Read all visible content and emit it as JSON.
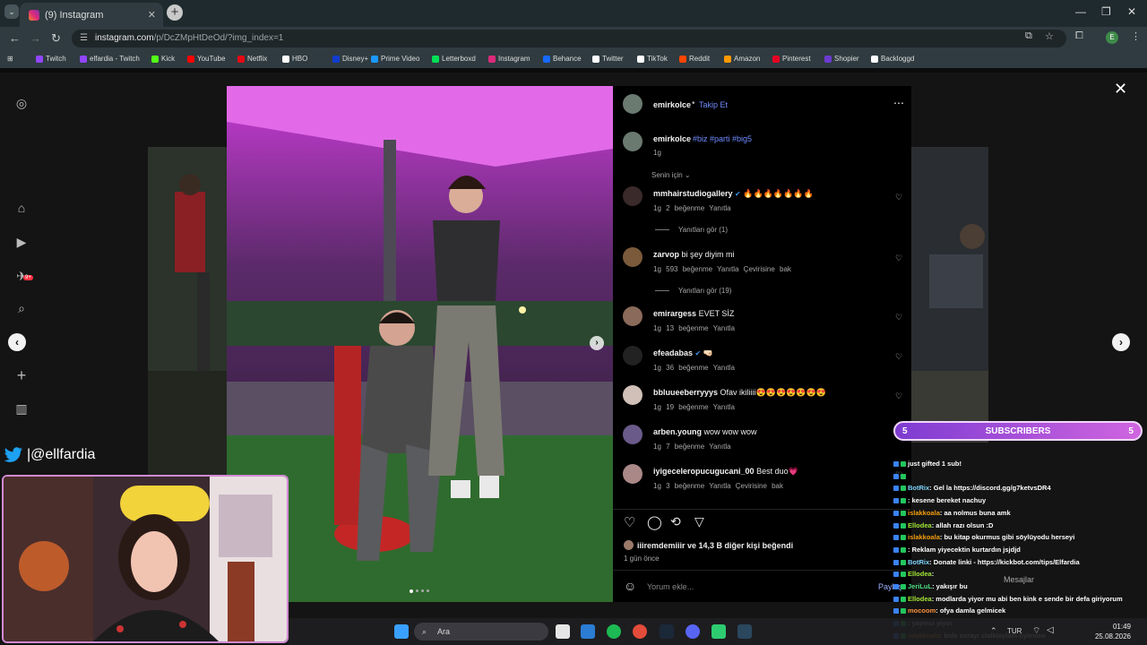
{
  "browser": {
    "tab_title": "(9) Instagram",
    "url_host": "instagram.com",
    "url_rest": "/p/DcZMpHtDeOd/?img_index=1",
    "profile_initial": "E",
    "bookmarks": [
      {
        "label": "Twitch",
        "color": "#9146ff"
      },
      {
        "label": "elfardia - Twitch",
        "color": "#9146ff"
      },
      {
        "label": "Kick",
        "color": "#53fc18"
      },
      {
        "label": "YouTube",
        "color": "#ff0000"
      },
      {
        "label": "Netflix",
        "color": "#e50914"
      },
      {
        "label": "HBO",
        "color": "#ffffff"
      },
      {
        "label": "Disney+",
        "color": "#113ccf"
      },
      {
        "label": "Prime Video",
        "color": "#1a98ff"
      },
      {
        "label": "Letterboxd",
        "color": "#00e054"
      },
      {
        "label": "Instagram",
        "color": "#dd2a7b"
      },
      {
        "label": "Behance",
        "color": "#1769ff"
      },
      {
        "label": "Twitter",
        "color": "#ffffff"
      },
      {
        "label": "TikTok",
        "color": "#ffffff"
      },
      {
        "label": "Reddit",
        "color": "#ff4500"
      },
      {
        "label": "Amazon",
        "color": "#ff9900"
      },
      {
        "label": "Pinterest",
        "color": "#e60023"
      },
      {
        "label": "Shopier",
        "color": "#6c3bd1"
      },
      {
        "label": "Backloggd",
        "color": "#ffffff"
      }
    ]
  },
  "instagram": {
    "notification_count": "9+",
    "post_author": "emirkolce",
    "follow_label": "Takip Et",
    "caption_user": "emirkolce",
    "caption_tags": "#biz #parti #big5",
    "caption_age": "1g",
    "sort_label": "Senin için",
    "comments": [
      {
        "user": "mmhairstudiogallery",
        "verified": true,
        "text": "🔥🔥🔥🔥🔥🔥🔥",
        "meta": "1g  2 beğenme  Yanıtla",
        "replies": "Yanıtları gör (1)"
      },
      {
        "user": "zarvop",
        "verified": false,
        "text": "bi şey diyim mi",
        "meta": "1g  593 beğenme  Yanıtla  Çevirisine bak",
        "replies": "Yanıtları gör (19)"
      },
      {
        "user": "emirargess",
        "verified": false,
        "text": "EVET SİZ",
        "meta": "1g  13 beğenme  Yanıtla",
        "replies": ""
      },
      {
        "user": "efeadabas",
        "verified": true,
        "text": "🤜🏻",
        "meta": "1g  36 beğenme  Yanıtla",
        "replies": ""
      },
      {
        "user": "bbluueeberryyys",
        "verified": false,
        "text": "Ofav ikiliiii😍😍😍😍😍😍😍",
        "meta": "1g  19 beğenme  Yanıtla",
        "replies": ""
      },
      {
        "user": "arben.young",
        "verified": false,
        "text": "wow wow wow",
        "meta": "1g  7 beğenme  Yanıtla",
        "replies": ""
      },
      {
        "user": "iyigeceleropucugucani_00",
        "verified": false,
        "text": "Best duo💗",
        "meta": "1g  3 beğenme  Yanıtla  Çevirisine bak",
        "replies": ""
      }
    ],
    "likes_text": "iiiremdemiiir ve 14,3 B diğer kişi beğendi",
    "post_age": "1 gün önce",
    "comment_placeholder": "Yorum ekle...",
    "post_button": "Paylaş",
    "messages_label": "Mesajlar"
  },
  "stream": {
    "twitter_handle": "|@ellfardia",
    "subscribers_label": "SUBSCRIBERS",
    "subscribers_count": "5",
    "chat": [
      {
        "user": "",
        "text": "just gifted 1 sub!",
        "color": "#ff6b6b"
      },
      {
        "user": "",
        "text": "",
        "color": "#ff6b6b"
      },
      {
        "user": "BotRix",
        "text": ": Gel la https://discord.gg/g7ketvsDR4",
        "color": "#7dd3fc"
      },
      {
        "user": "",
        "text": ": kesene bereket nachuy",
        "color": "#c084fc"
      },
      {
        "user": "islakkoala",
        "text": ": aa nolmus buna amk",
        "color": "#f59e0b"
      },
      {
        "user": "Ellodea",
        "text": ": allah razı olsun :D",
        "color": "#a3e635"
      },
      {
        "user": "islakkoala",
        "text": ": bu kitap okurmus gibi söylüyodu herseyi",
        "color": "#f59e0b"
      },
      {
        "user": "",
        "text": ": Reklam yiyecektin kurtardın jsjdjd",
        "color": "#ff6b6b"
      },
      {
        "user": "BotRix",
        "text": ": Donate linki - https://kickbot.com/tips/Elfardia",
        "color": "#7dd3fc"
      },
      {
        "user": "Ellodea",
        "text": ":",
        "color": "#a3e635"
      },
      {
        "user": "JeriLuL",
        "text": ": yakışır bu",
        "color": "#4ade80"
      },
      {
        "user": "Ellodea",
        "text": ": modlarda yiyor mu abi ben kink e sende bir defa giriyorum",
        "color": "#a3e635"
      },
      {
        "user": "mocoom",
        "text": ": ofya damla gelmicek",
        "color": "#fb923c"
      },
      {
        "user": "",
        "text": ": yayıncı yiyor",
        "color": "#ef4444"
      },
      {
        "user": "islakkoala",
        "text": ": bide esrayı stalklaylam öylesine",
        "color": "#f59e0b"
      }
    ]
  },
  "taskbar": {
    "search_label": "Ara",
    "language": "TUR",
    "time": "01:49",
    "date": "25.08.2026"
  }
}
